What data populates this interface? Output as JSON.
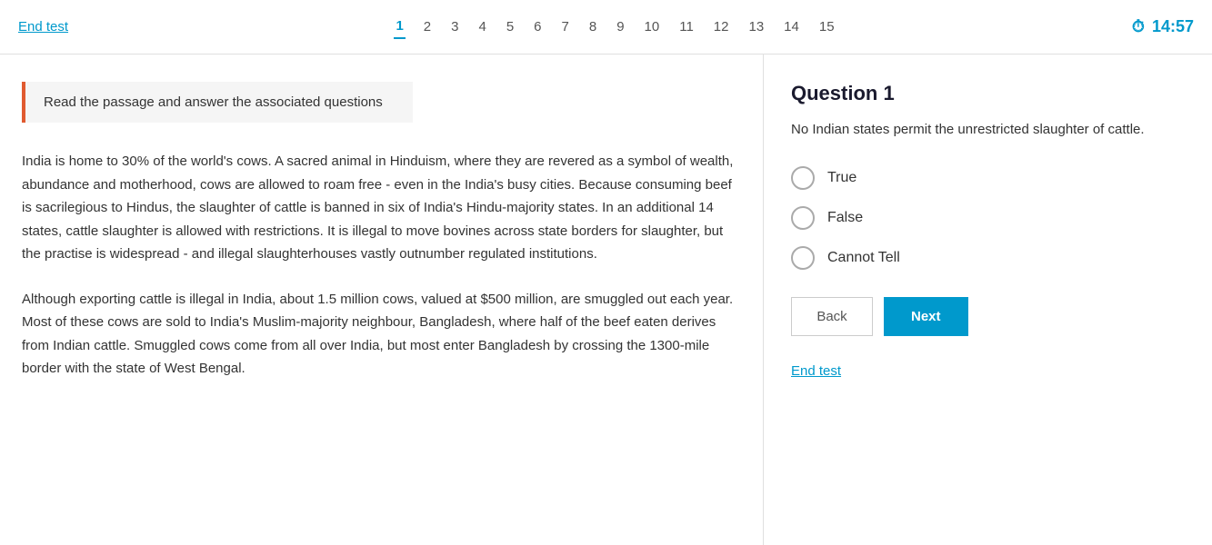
{
  "header": {
    "end_test_label": "End test",
    "nav_numbers": [
      "1",
      "2",
      "3",
      "4",
      "5",
      "6",
      "7",
      "8",
      "9",
      "10",
      "11",
      "12",
      "13",
      "14",
      "15"
    ],
    "active_number": "1",
    "timer": "14:57"
  },
  "instruction": {
    "text": "Read the passage and answer the associated questions"
  },
  "passage": {
    "paragraph1": "India is home to 30% of the world's cows. A sacred animal in Hinduism, where they are revered as a symbol of wealth, abundance and motherhood, cows are allowed to roam free - even in the India's busy cities. Because consuming beef is sacrilegious to Hindus, the slaughter of cattle is banned in six of India's Hindu-majority states. In an additional 14 states, cattle slaughter is allowed with restrictions. It is illegal to move bovines across state borders for slaughter, but the practise is widespread - and illegal slaughterhouses vastly outnumber regulated institutions.",
    "paragraph2": "Although exporting cattle is illegal in India, about 1.5 million cows, valued at $500 million, are smuggled out each year. Most of these cows are sold to India's Muslim-majority neighbour, Bangladesh, where half of the beef eaten derives from Indian cattle. Smuggled cows come from all over India, but most enter Bangladesh by crossing the 1300-mile border with the state of West Bengal."
  },
  "question": {
    "title": "Question 1",
    "text": "No Indian states permit the unrestricted slaughter of cattle.",
    "options": [
      {
        "label": "True",
        "id": "opt-true"
      },
      {
        "label": "False",
        "id": "opt-false"
      },
      {
        "label": "Cannot Tell",
        "id": "opt-cannot-tell"
      }
    ]
  },
  "buttons": {
    "back_label": "Back",
    "next_label": "Next"
  },
  "footer": {
    "end_test_label": "End test"
  }
}
